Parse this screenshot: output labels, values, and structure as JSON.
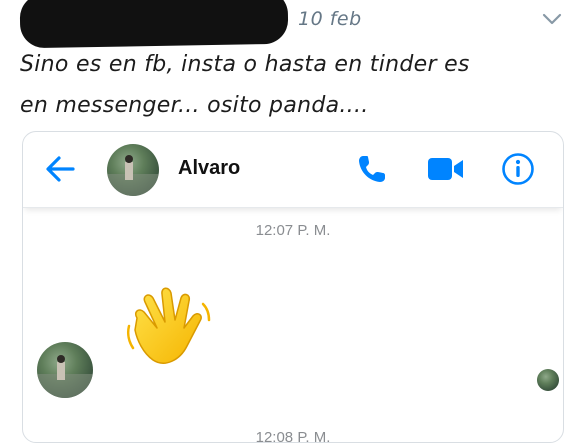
{
  "tweet": {
    "date": "10 feb",
    "text_line1": "Sino es en fb, insta o hasta en tinder es",
    "text_line2": "en messenger... osito panda...."
  },
  "chat": {
    "contact_name": "Alvaro",
    "timestamp": "12:07 P. M.",
    "timestamp_partial": "12:08 P. M.",
    "message_emoji": "waving-hand"
  },
  "colors": {
    "messenger_blue": "#0084ff",
    "header_text": "#111111",
    "timestamp": "#8a8d91"
  },
  "icons": [
    "chevron-down-icon",
    "back-arrow-icon",
    "phone-icon",
    "video-camera-icon",
    "info-icon",
    "waving-hand-icon"
  ]
}
